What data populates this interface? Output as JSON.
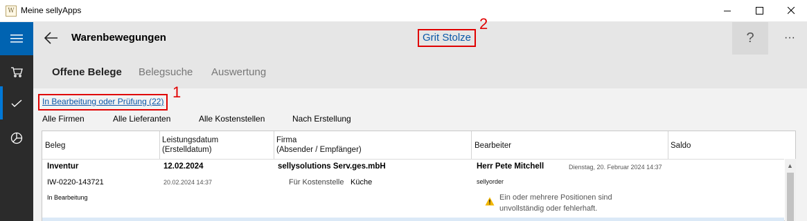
{
  "window": {
    "title": "Meine sellyApps",
    "icon": "W",
    "minimize_label": "—",
    "maximize_label": "☐",
    "close_label": "✕"
  },
  "header": {
    "title": "Warenbewegungen",
    "user": "Grit Stolze",
    "help": "?",
    "more": "···"
  },
  "callouts": {
    "one": "1",
    "two": "2"
  },
  "tabs": [
    {
      "label": "Offene Belege",
      "active": true
    },
    {
      "label": "Belegsuche",
      "active": false
    },
    {
      "label": "Auswertung",
      "active": false
    }
  ],
  "filter": {
    "status_link": "In Bearbeitung oder Prüfung (22)",
    "buttons": [
      "Alle Firmen",
      "Alle Lieferanten",
      "Alle Kostenstellen",
      "Nach Erstellung"
    ]
  },
  "table": {
    "columns": [
      {
        "line1": "Beleg",
        "line2": ""
      },
      {
        "line1": "Leistungsdatum",
        "line2": "(Erstelldatum)"
      },
      {
        "line1": "Firma",
        "line2": "(Absender / Empfänger)"
      },
      {
        "line1": "Bearbeiter",
        "line2": ""
      },
      {
        "line1": "Saldo",
        "line2": ""
      }
    ],
    "rows": [
      {
        "type": "Inventur",
        "number": "IW-0220-143721",
        "status": "In Bearbeitung",
        "date": "12.02.2024",
        "created": "20.02.2024 14:37",
        "company": "sellysolutions Serv.ges.mbH",
        "cost_center_label": "Für Kostenstelle",
        "cost_center": "Küche",
        "editor": "Herr Pete Mitchell",
        "edited_at": "Dienstag, 20. Februar 2024 14:37",
        "editor_app": "sellyorder",
        "warning": "Ein oder mehrere Positionen sind unvollständig oder fehlerhaft."
      }
    ]
  },
  "colors": {
    "accent": "#0063b1",
    "link": "#0a57a8",
    "callout": "#e00000",
    "rail": "#2b2b2b",
    "warning": "#f2b600"
  }
}
